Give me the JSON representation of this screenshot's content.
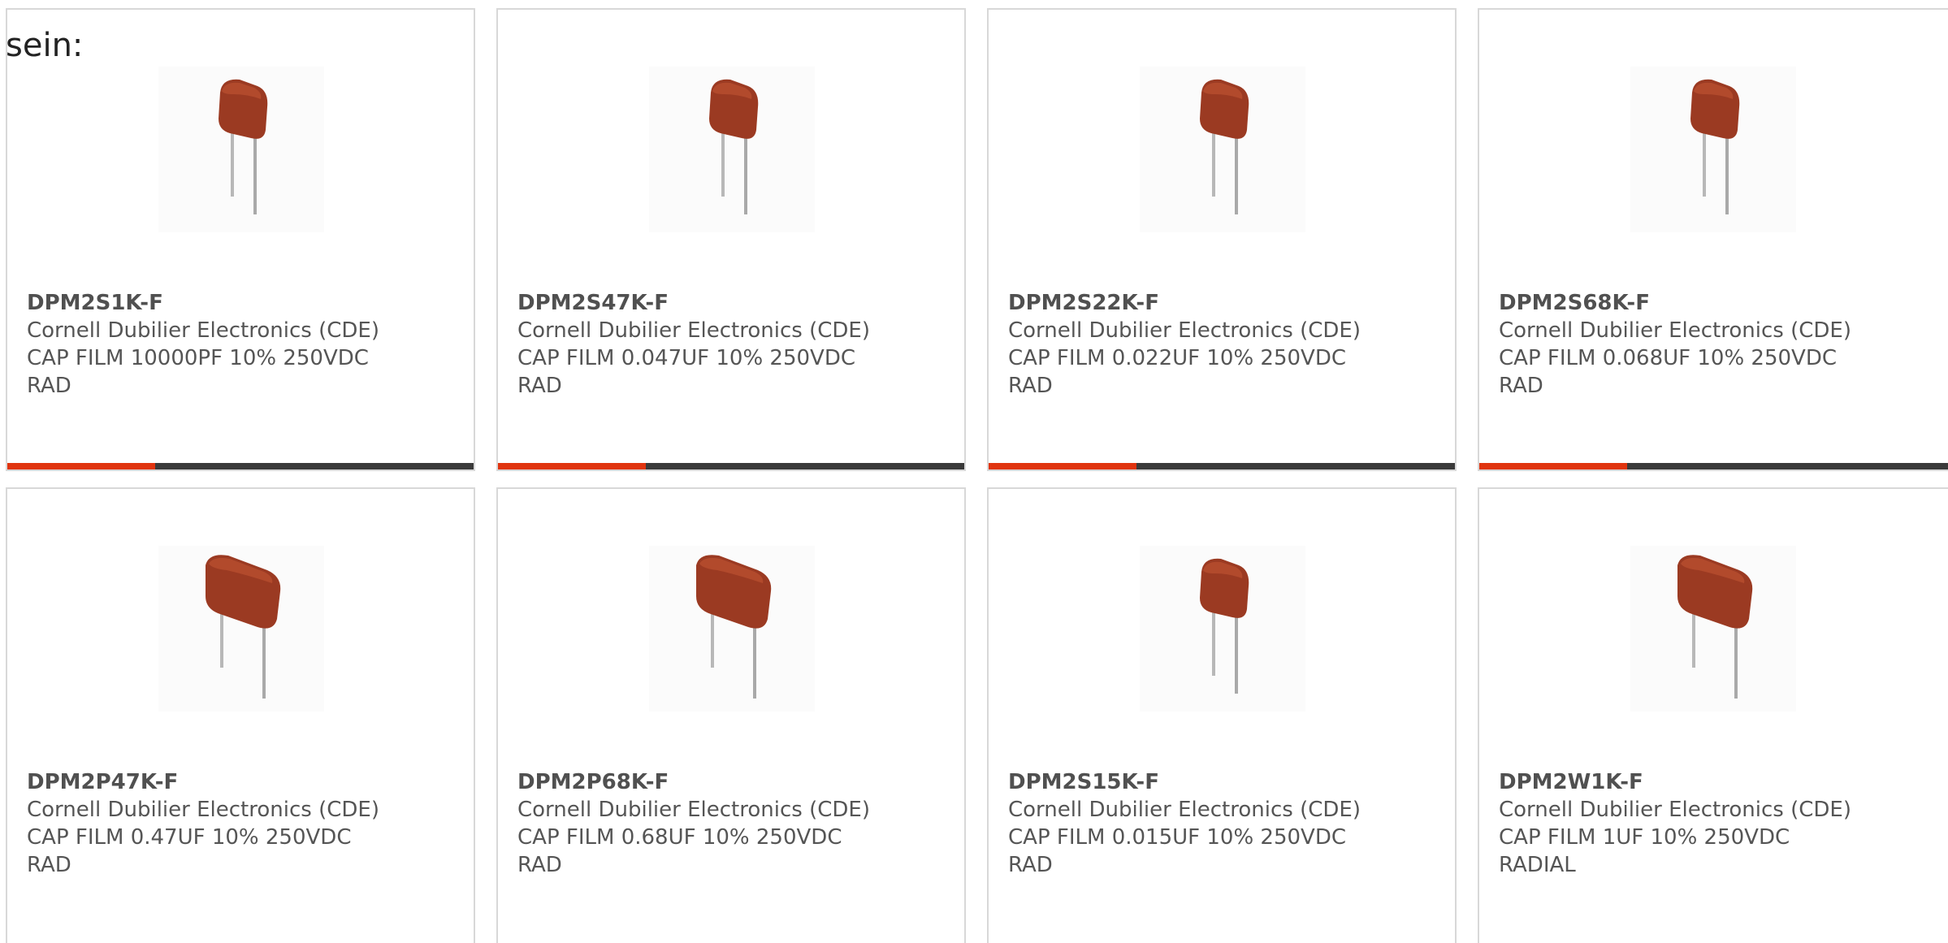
{
  "intro_text": "sein:",
  "colors": {
    "accent": "#e0340f",
    "bar": "#3a3a3a",
    "capacitor": "#9b3a22",
    "lead": "#b8b8b8"
  },
  "products": [
    {
      "part": "DPM2S1K-F",
      "manufacturer": "Cornell Dubilier Electronics (CDE)",
      "desc1": "CAP FILM 10000PF 10% 250VDC",
      "desc2": "RAD",
      "icon": "capacitor-small-image"
    },
    {
      "part": "DPM2S47K-F",
      "manufacturer": "Cornell Dubilier Electronics (CDE)",
      "desc1": "CAP FILM 0.047UF 10% 250VDC",
      "desc2": "RAD",
      "icon": "capacitor-small-image"
    },
    {
      "part": "DPM2S22K-F",
      "manufacturer": "Cornell Dubilier Electronics (CDE)",
      "desc1": "CAP FILM 0.022UF 10% 250VDC",
      "desc2": "RAD",
      "icon": "capacitor-small-image"
    },
    {
      "part": "DPM2S68K-F",
      "manufacturer": "Cornell Dubilier Electronics (CDE)",
      "desc1": "CAP FILM 0.068UF 10% 250VDC",
      "desc2": "RAD",
      "icon": "capacitor-small-image"
    },
    {
      "part": "DPM2P47K-F",
      "manufacturer": "Cornell Dubilier Electronics (CDE)",
      "desc1": "CAP FILM 0.47UF 10% 250VDC",
      "desc2": "RAD",
      "icon": "capacitor-large-image"
    },
    {
      "part": "DPM2P68K-F",
      "manufacturer": "Cornell Dubilier Electronics (CDE)",
      "desc1": "CAP FILM 0.68UF 10% 250VDC",
      "desc2": "RAD",
      "icon": "capacitor-large-image"
    },
    {
      "part": "DPM2S15K-F",
      "manufacturer": "Cornell Dubilier Electronics (CDE)",
      "desc1": "CAP FILM 0.015UF 10% 250VDC",
      "desc2": "RAD",
      "icon": "capacitor-small-image"
    },
    {
      "part": "DPM2W1K-F",
      "manufacturer": "Cornell Dubilier Electronics (CDE)",
      "desc1": "CAP FILM 1UF 10% 250VDC",
      "desc2": "RADIAL",
      "icon": "capacitor-large-image"
    }
  ]
}
